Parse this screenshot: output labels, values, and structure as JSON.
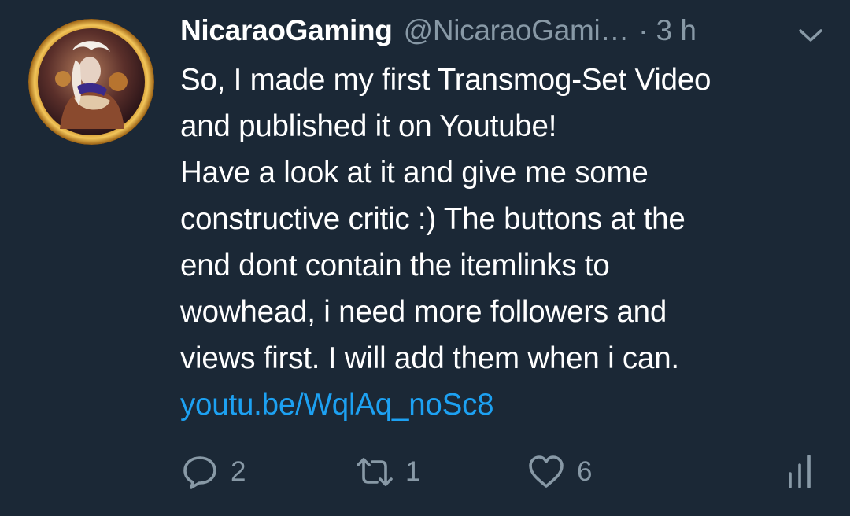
{
  "tweet": {
    "display_name": "NicaraoGaming",
    "handle": "@NicaraoGami…",
    "separator": "·",
    "time": "3 h",
    "text_lines": [
      "So, I made my first Transmog-Set Video",
      "and published it on Youtube!",
      "Have a look at it and give me some",
      "constructive critic :) The buttons at the",
      "end dont contain the itemlinks to",
      "wowhead, i need more followers and",
      "views first. I will add them when i can."
    ],
    "link": "youtu.be/WqlAq_noSc8",
    "actions": {
      "reply_count": "2",
      "retweet_count": "1",
      "like_count": "6"
    }
  },
  "icons": {
    "menu": "chevron-down-icon",
    "reply": "reply-bubble-icon",
    "retweet": "retweet-arrows-icon",
    "like": "heart-icon",
    "stats": "analytics-bars-icon"
  },
  "colors": {
    "background": "#1b2836",
    "text": "#ffffff",
    "muted": "#8899a6",
    "link": "#1da1f2"
  }
}
